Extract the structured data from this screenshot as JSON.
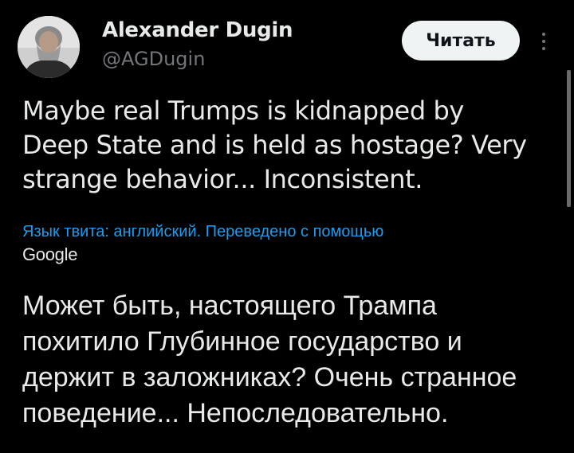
{
  "author": {
    "name": "Alexander Dugin",
    "handle": "@AGDugin"
  },
  "actions": {
    "follow_label": "Читать",
    "more_icon": "more-vertical-icon"
  },
  "tweet": {
    "lines": [
      "Maybe real Trumps is kidnapped by",
      "Deep State and is held as hostage? Very",
      "strange behavior... Inconsistent."
    ]
  },
  "translation": {
    "label": "Язык твита: английский. Переведено с помощью",
    "provider": "Google",
    "lines": [
      "Может быть, настоящего Трампа",
      "похитило Глубинное государство и",
      "держит в заложниках? Очень странное",
      "поведение... Непоследовательно."
    ]
  },
  "colors": {
    "background": "#000000",
    "text": "#e7e9ea",
    "muted": "#71767b",
    "link": "#1d9bf0",
    "button_bg": "#eff3f4"
  }
}
